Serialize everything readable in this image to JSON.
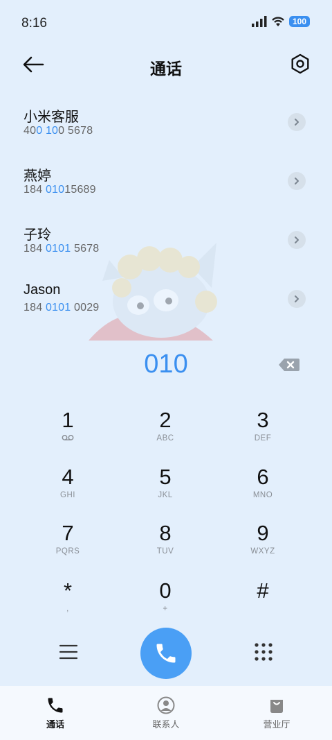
{
  "status_bar": {
    "time": "8:16",
    "battery": "100"
  },
  "header": {
    "title": "通话"
  },
  "contacts": [
    {
      "name": "小米客服",
      "number_parts": [
        "40",
        "0 10",
        "0 5678"
      ]
    },
    {
      "name": "燕婷",
      "number_parts": [
        "184 ",
        "010",
        "15689"
      ]
    },
    {
      "name": "子玲",
      "number_parts": [
        "184 ",
        "0101",
        " 5678"
      ]
    },
    {
      "name": "Jason",
      "number_parts": [
        "184 ",
        "0101",
        " 0029"
      ]
    }
  ],
  "dialed_number": "010",
  "keypad": [
    {
      "digit": "1",
      "sub": ""
    },
    {
      "digit": "2",
      "sub": "ABC"
    },
    {
      "digit": "3",
      "sub": "DEF"
    },
    {
      "digit": "4",
      "sub": "GHI"
    },
    {
      "digit": "5",
      "sub": "JKL"
    },
    {
      "digit": "6",
      "sub": "MNO"
    },
    {
      "digit": "7",
      "sub": "PQRS"
    },
    {
      "digit": "8",
      "sub": "TUV"
    },
    {
      "digit": "9",
      "sub": "WXYZ"
    },
    {
      "digit": "*",
      "sub": ","
    },
    {
      "digit": "0",
      "sub": "+"
    },
    {
      "digit": "#",
      "sub": ""
    }
  ],
  "bottom_nav": [
    {
      "label": "通话",
      "icon": "phone-icon",
      "active": true
    },
    {
      "label": "联系人",
      "icon": "person-icon",
      "active": false
    },
    {
      "label": "营业厅",
      "icon": "shopping-bag-icon",
      "active": false
    }
  ],
  "colors": {
    "accent": "#3a8ff0",
    "call_button": "#4a9ff5",
    "background": "#e3effc"
  }
}
